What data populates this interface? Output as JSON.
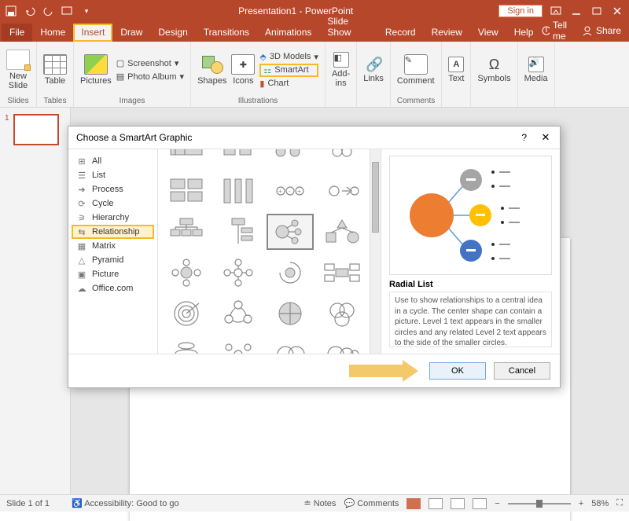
{
  "titlebar": {
    "title": "Presentation1 - PowerPoint",
    "signin": "Sign in"
  },
  "tabs": {
    "file": "File",
    "home": "Home",
    "insert": "Insert",
    "draw": "Draw",
    "design": "Design",
    "transitions": "Transitions",
    "animations": "Animations",
    "slideshow": "Slide Show",
    "record": "Record",
    "review": "Review",
    "view": "View",
    "help": "Help",
    "tellme": "Tell me",
    "share": "Share"
  },
  "ribbon": {
    "slides": {
      "label": "Slides",
      "newslide": "New\nSlide"
    },
    "tables": {
      "label": "Tables",
      "table": "Table"
    },
    "images": {
      "label": "Images",
      "pictures": "Pictures",
      "screenshot": "Screenshot",
      "photoalbum": "Photo Album"
    },
    "illustrations": {
      "label": "Illustrations",
      "shapes": "Shapes",
      "icons": "Icons",
      "models": "3D Models",
      "smartart": "SmartArt",
      "chart": "Chart"
    },
    "addins": {
      "label": "",
      "btn": "Add-\nins"
    },
    "links": {
      "label": "",
      "btn": "Links"
    },
    "comments": {
      "label": "Comments",
      "btn": "Comment"
    },
    "text": {
      "label": "",
      "btn": "Text"
    },
    "symbols": {
      "label": "",
      "btn": "Symbols"
    },
    "media": {
      "label": "",
      "btn": "Media"
    }
  },
  "dialog": {
    "title": "Choose a SmartArt Graphic",
    "help": "?",
    "categories": [
      "All",
      "List",
      "Process",
      "Cycle",
      "Hierarchy",
      "Relationship",
      "Matrix",
      "Pyramid",
      "Picture",
      "Office.com"
    ],
    "selected_category": "Relationship",
    "preview": {
      "title": "Radial List",
      "desc": "Use to show relationships to a central idea in a cycle. The center shape can contain a picture. Level 1 text appears in the smaller circles and any related Level 2 text appears to the side of the smaller circles."
    },
    "buttons": {
      "ok": "OK",
      "cancel": "Cancel"
    }
  },
  "status": {
    "slide": "Slide 1 of 1",
    "lang": "",
    "access": "Accessibility: Good to go",
    "notes": "Notes",
    "comments": "Comments",
    "zoom": "58%"
  },
  "thumbs": {
    "num1": "1"
  }
}
